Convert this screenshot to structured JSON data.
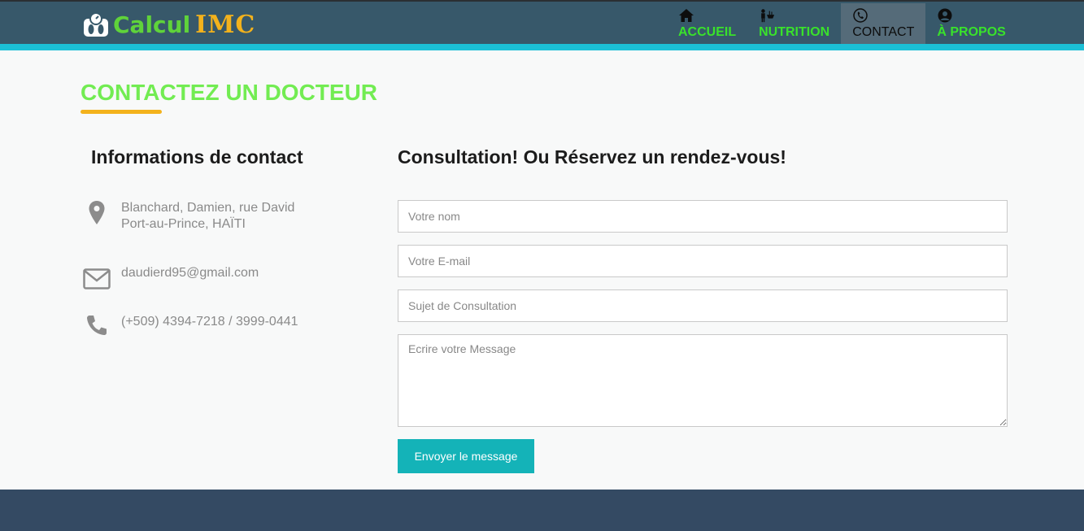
{
  "logo": {
    "text_a": "Calcul",
    "text_b": "IMC"
  },
  "nav": {
    "items": [
      {
        "label": "ACCUEIL",
        "icon": "home-icon"
      },
      {
        "label": "NUTRITION",
        "icon": "nutrition-icon"
      },
      {
        "label": "CONTACT",
        "icon": "phone-icon",
        "active": true
      },
      {
        "label": "À PROPOS",
        "icon": "user-icon"
      }
    ]
  },
  "page": {
    "title": "CONTACTEZ UN DOCTEUR"
  },
  "contact": {
    "heading": "Informations de contact",
    "address_line1": "Blanchard, Damien, rue David",
    "address_line2": "Port-au-Prince, HAÏTI",
    "email": "daudierd95@gmail.com",
    "phone": "(+509) 4394-7218 / 3999-0441"
  },
  "form": {
    "heading": "Consultation! Ou Réservez un rendez-vous!",
    "name_placeholder": "Votre nom",
    "email_placeholder": "Votre E-mail",
    "subject_placeholder": "Sujet de Consultation",
    "message_placeholder": "Ecrire votre Message",
    "submit_label": "Envoyer le message"
  },
  "colors": {
    "header_bg": "#37586a",
    "stripe": "#1bbfd6",
    "accent_green": "#72ec52",
    "accent_orange": "#f3b21c",
    "button": "#14b3b8",
    "footer_bg": "#344a63"
  }
}
